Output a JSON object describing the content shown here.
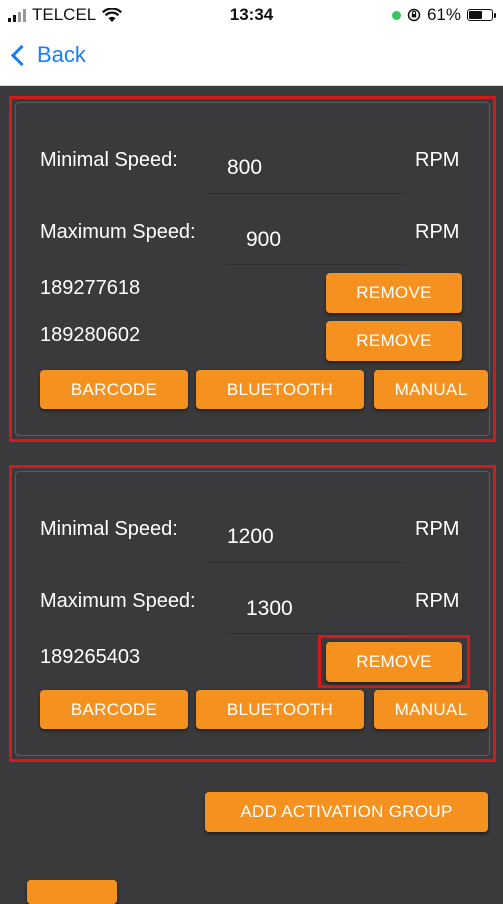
{
  "status_bar": {
    "carrier": "TELCEL",
    "time": "13:34",
    "battery_percent": "61%",
    "battery_level": 0.61
  },
  "nav": {
    "back_label": "Back"
  },
  "groups": [
    {
      "min_label": "Minimal Speed:",
      "min_value": "800",
      "min_unit": "RPM",
      "max_label": "Maximum Speed:",
      "max_value": "900",
      "max_unit": "RPM",
      "devices": [
        {
          "id": "189277618",
          "remove_label": "REMOVE"
        },
        {
          "id": "189280602",
          "remove_label": "REMOVE"
        }
      ],
      "barcode_label": "BARCODE",
      "bluetooth_label": "BLUETOOTH",
      "manual_label": "MANUAL"
    },
    {
      "min_label": "Minimal Speed:",
      "min_value": "1200",
      "min_unit": "RPM",
      "max_label": "Maximum Speed:",
      "max_value": "1300",
      "max_unit": "RPM",
      "devices": [
        {
          "id": "189265403",
          "remove_label": "REMOVE"
        }
      ],
      "barcode_label": "BARCODE",
      "bluetooth_label": "BLUETOOTH",
      "manual_label": "MANUAL"
    }
  ],
  "add_group_label": "ADD ACTIVATION GROUP",
  "colors": {
    "accent": "#f5921f",
    "highlight": "#d21a1a",
    "background": "#3a3a3c",
    "link": "#1a7ef5"
  }
}
